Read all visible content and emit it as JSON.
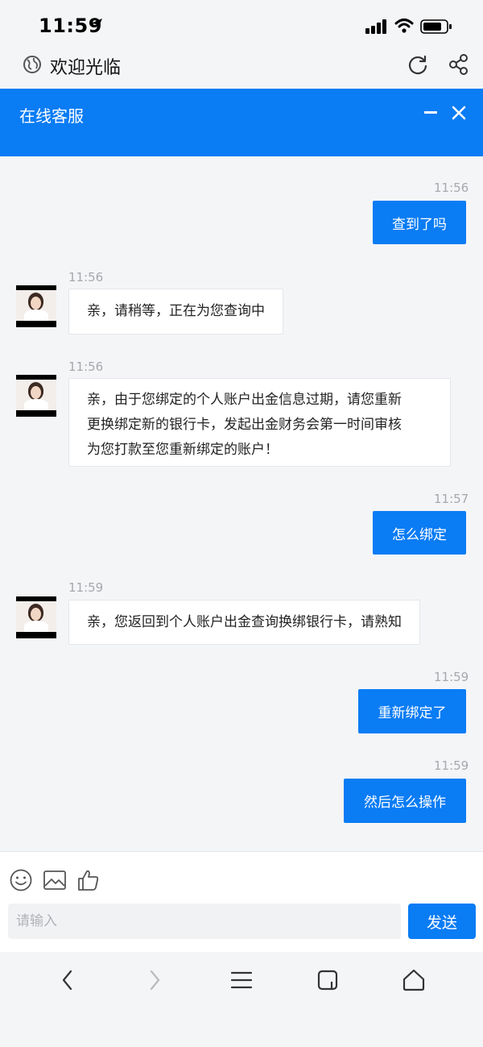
{
  "status_bar": {
    "time": "11:59",
    "icons": [
      "location-arrow-icon",
      "signal-icon",
      "wifi-icon",
      "battery-icon"
    ]
  },
  "browser": {
    "title": "欢迎光临",
    "icons": [
      "globe-icon",
      "refresh-icon",
      "share-icon"
    ]
  },
  "header": {
    "title": "在线客服",
    "minimize_icon": "minimize-icon",
    "close_icon": "close-icon"
  },
  "messages": [
    {
      "time": "11:56",
      "sender": "user",
      "text": "查到了吗"
    },
    {
      "time": "11:56",
      "sender": "agent",
      "text": "亲，请稍等，正在为您查询中"
    },
    {
      "time": "11:56",
      "sender": "agent",
      "lines": [
        "亲，由于您绑定的个人账户出金信息过期，请您重新",
        "更换绑定新的银行卡，发起出金财务会第一时间审核",
        "为您打款至您重新绑定的账户！"
      ]
    },
    {
      "time": "11:57",
      "sender": "user",
      "text": "怎么绑定"
    },
    {
      "time": "11:59",
      "sender": "agent",
      "text": "亲，您返回到个人账户出金查询换绑银行卡，请熟知"
    },
    {
      "time": "11:59",
      "sender": "user",
      "text": "重新绑定了"
    },
    {
      "time": "11:59",
      "sender": "user",
      "text": "然后怎么操作"
    }
  ],
  "toolbar": {
    "icons": [
      "emoji-icon",
      "image-icon",
      "thumbs-up-icon"
    ]
  },
  "composer": {
    "placeholder": "请输入",
    "value": "",
    "send_label": "发送"
  },
  "colors": {
    "accent": "#0a7cf4",
    "background": "#f4f5f7"
  },
  "bottom_nav": {
    "icons": [
      "back-icon",
      "forward-icon",
      "menu-icon",
      "tabs-icon",
      "home-icon"
    ]
  }
}
